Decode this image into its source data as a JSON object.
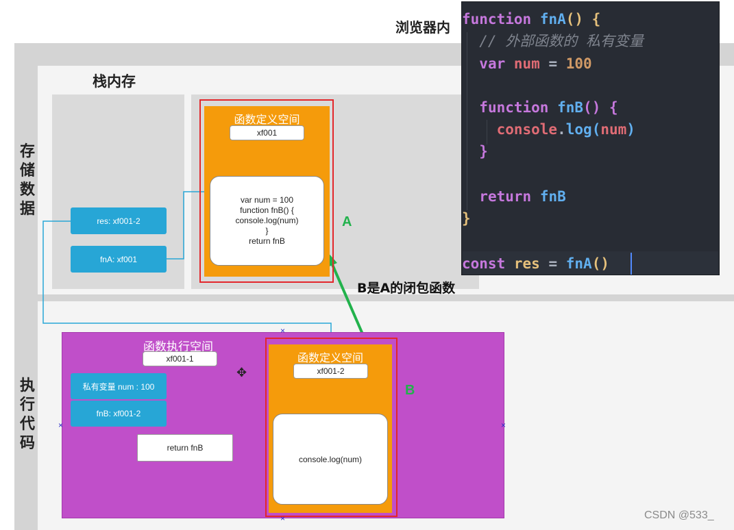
{
  "header_text": "浏览器内",
  "stack": {
    "title": "栈内存",
    "res_box": "res: xf001-2",
    "fna_box": "fnA: xf001"
  },
  "row_labels": {
    "storage": [
      "存",
      "储",
      "数",
      "据"
    ],
    "execution": [
      "执",
      "行",
      "代",
      "码"
    ]
  },
  "heap_block_a": {
    "title": "函数定义空间",
    "address": "xf001",
    "code_lines": [
      "var num = 100",
      "function fnB() {",
      "console.log(num)",
      "}",
      "return fnB"
    ],
    "tag": "A"
  },
  "closure_note": "B是A的闭包函数",
  "exec_space": {
    "title": "函数执行空间",
    "address": "xf001-1",
    "private_var": "私有变量 num : 100",
    "fnb_box": "fnB: xf001-2",
    "return_box": "return fnB"
  },
  "heap_block_b": {
    "title": "函数定义空间",
    "address": "xf001-2",
    "code_lines": [
      "console.log(num)"
    ],
    "tag": "B"
  },
  "code_editor": {
    "lines": [
      "function fnA() {",
      "  // 外部函数的 私有变量",
      "  var num = 100",
      "",
      "  function fnB() {",
      "    console.log(num)",
      "  }",
      "",
      "  return fnB",
      "}",
      "",
      "const res = fnA()"
    ],
    "colors": {
      "background": "#282c34",
      "keyword": "#c678dd",
      "function_name": "#61afef",
      "number": "#d19a66",
      "comment": "#7f848e",
      "variable": "#e06c75",
      "brackets": "#e5c07b"
    }
  },
  "watermark": "CSDN @533_",
  "colors": {
    "orange_block": "#f59b0b",
    "purple_block": "#c04fc9",
    "blue_box": "#27a6d6",
    "red_frame": "#e3262b",
    "green_arrow": "#22b24c"
  }
}
